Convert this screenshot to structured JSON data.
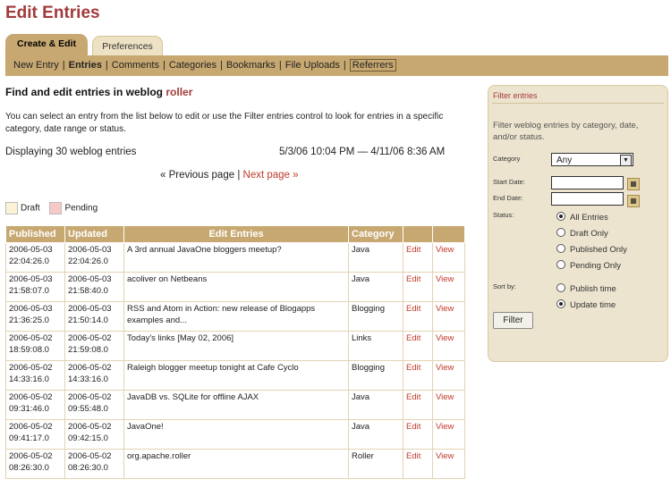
{
  "page": {
    "title": "Edit Entries"
  },
  "tabs": [
    {
      "label": "Create & Edit"
    },
    {
      "label": "Preferences"
    }
  ],
  "subnav": {
    "items": [
      "New Entry",
      "Entries",
      "Comments",
      "Categories",
      "Bookmarks",
      "File Uploads",
      "Referrers"
    ],
    "separator": "|"
  },
  "main": {
    "title_prefix": "Find and edit entries in weblog",
    "weblog": "roller",
    "intro": "You can select an entry from the list below to edit or use the Filter entries control to look for entries in a specific category, date range or status.",
    "displaying": "Displaying 30 weblog entries",
    "date_range": "5/3/06 10:04 PM — 4/11/06 8:36 AM",
    "pager": {
      "prev": "« Previous page",
      "separator": "|",
      "next": "Next page »"
    },
    "legend": {
      "draft": "Draft",
      "pending": "Pending"
    }
  },
  "table": {
    "headers": [
      "Published",
      "Updated",
      "Edit Entries",
      "Category",
      "",
      ""
    ],
    "edit_label": "Edit",
    "view_label": "View",
    "rows": [
      {
        "published": [
          "2006-05-03",
          "22:04:26.0"
        ],
        "updated": [
          "2006-05-03",
          "22:04:26.0"
        ],
        "title": "A 3rd annual JavaOne bloggers meetup?",
        "category": "Java"
      },
      {
        "published": [
          "2006-05-03",
          "21:58:07.0"
        ],
        "updated": [
          "2006-05-03",
          "21:58:40.0"
        ],
        "title": "acoliver on Netbeans",
        "category": "Java"
      },
      {
        "published": [
          "2006-05-03",
          "21:36:25.0"
        ],
        "updated": [
          "2006-05-03",
          "21:50:14.0"
        ],
        "title": "RSS and Atom in Action: new release of Blogapps examples and...",
        "category": "Blogging"
      },
      {
        "published": [
          "2006-05-02",
          "18:59:08.0"
        ],
        "updated": [
          "2006-05-02",
          "21:59:08.0"
        ],
        "title": "Today's links [May 02, 2006]",
        "category": "Links"
      },
      {
        "published": [
          "2006-05-02",
          "14:33:16.0"
        ],
        "updated": [
          "2006-05-02",
          "14:33:16.0"
        ],
        "title": "Raleigh blogger meetup tonight at Cafe Cyclo",
        "category": "Blogging"
      },
      {
        "published": [
          "2006-05-02",
          "09:31:46.0"
        ],
        "updated": [
          "2006-05-02",
          "09:55:48.0"
        ],
        "title": "JavaDB vs. SQLite for offline AJAX",
        "category": "Java"
      },
      {
        "published": [
          "2006-05-02",
          "09:41:17.0"
        ],
        "updated": [
          "2006-05-02",
          "09:42:15.0"
        ],
        "title": "JavaOne!",
        "category": "Java"
      },
      {
        "published": [
          "2006-05-02",
          "08:26:30.0"
        ],
        "updated": [
          "2006-05-02",
          "08:26:30.0"
        ],
        "title": "org.apache.roller",
        "category": "Roller"
      }
    ]
  },
  "filter": {
    "title": "Filter entries",
    "description": "Filter weblog entries by category, date, and/or status.",
    "category_label": "Category",
    "category_value": "Any",
    "start_date_label": "Start Date:",
    "end_date_label": "End Date:",
    "status_label": "Status:",
    "status_options": [
      "All Entries",
      "Draft Only",
      "Published Only",
      "Pending Only"
    ],
    "sort_label": "Sort by:",
    "sort_options": [
      "Publish time",
      "Update time"
    ],
    "button": "Filter"
  },
  "colors": {
    "accent": "#a23a3a",
    "tan": "#c7a871",
    "panel": "#ede4cf",
    "link": "#c0392b"
  },
  "icons": {
    "select_arrow": "chevron-down-icon",
    "calendar": "calendar-icon"
  }
}
